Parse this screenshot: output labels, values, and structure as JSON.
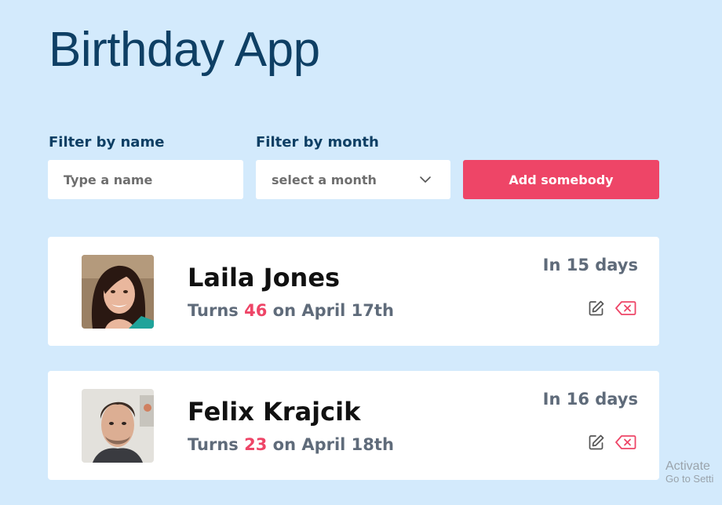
{
  "header": {
    "title": "Birthday App"
  },
  "filters": {
    "name_label": "Filter by name",
    "name_placeholder": "Type a name",
    "month_label": "Filter by month",
    "month_value": "select a month"
  },
  "actions": {
    "add_label": "Add somebody"
  },
  "people": [
    {
      "name": "Laila Jones",
      "turns_prefix": "Turns",
      "age": "46",
      "date_text": "on April 17th",
      "days_left": "In 15 days",
      "avatar": "woman-portrait"
    },
    {
      "name": "Felix Krajcik",
      "turns_prefix": "Turns",
      "age": "23",
      "date_text": "on April 18th",
      "days_left": "In 16 days",
      "avatar": "man-portrait"
    }
  ],
  "icons": {
    "edit": "edit-icon",
    "delete": "delete-icon",
    "dropdown": "chevron-down-icon"
  },
  "watermark": {
    "line1": "Activate",
    "line2": "Go to Setti"
  },
  "colors": {
    "background": "#d3eafc",
    "accent": "#ee4567",
    "title": "#0e3f64",
    "muted": "#5f6b7a"
  }
}
